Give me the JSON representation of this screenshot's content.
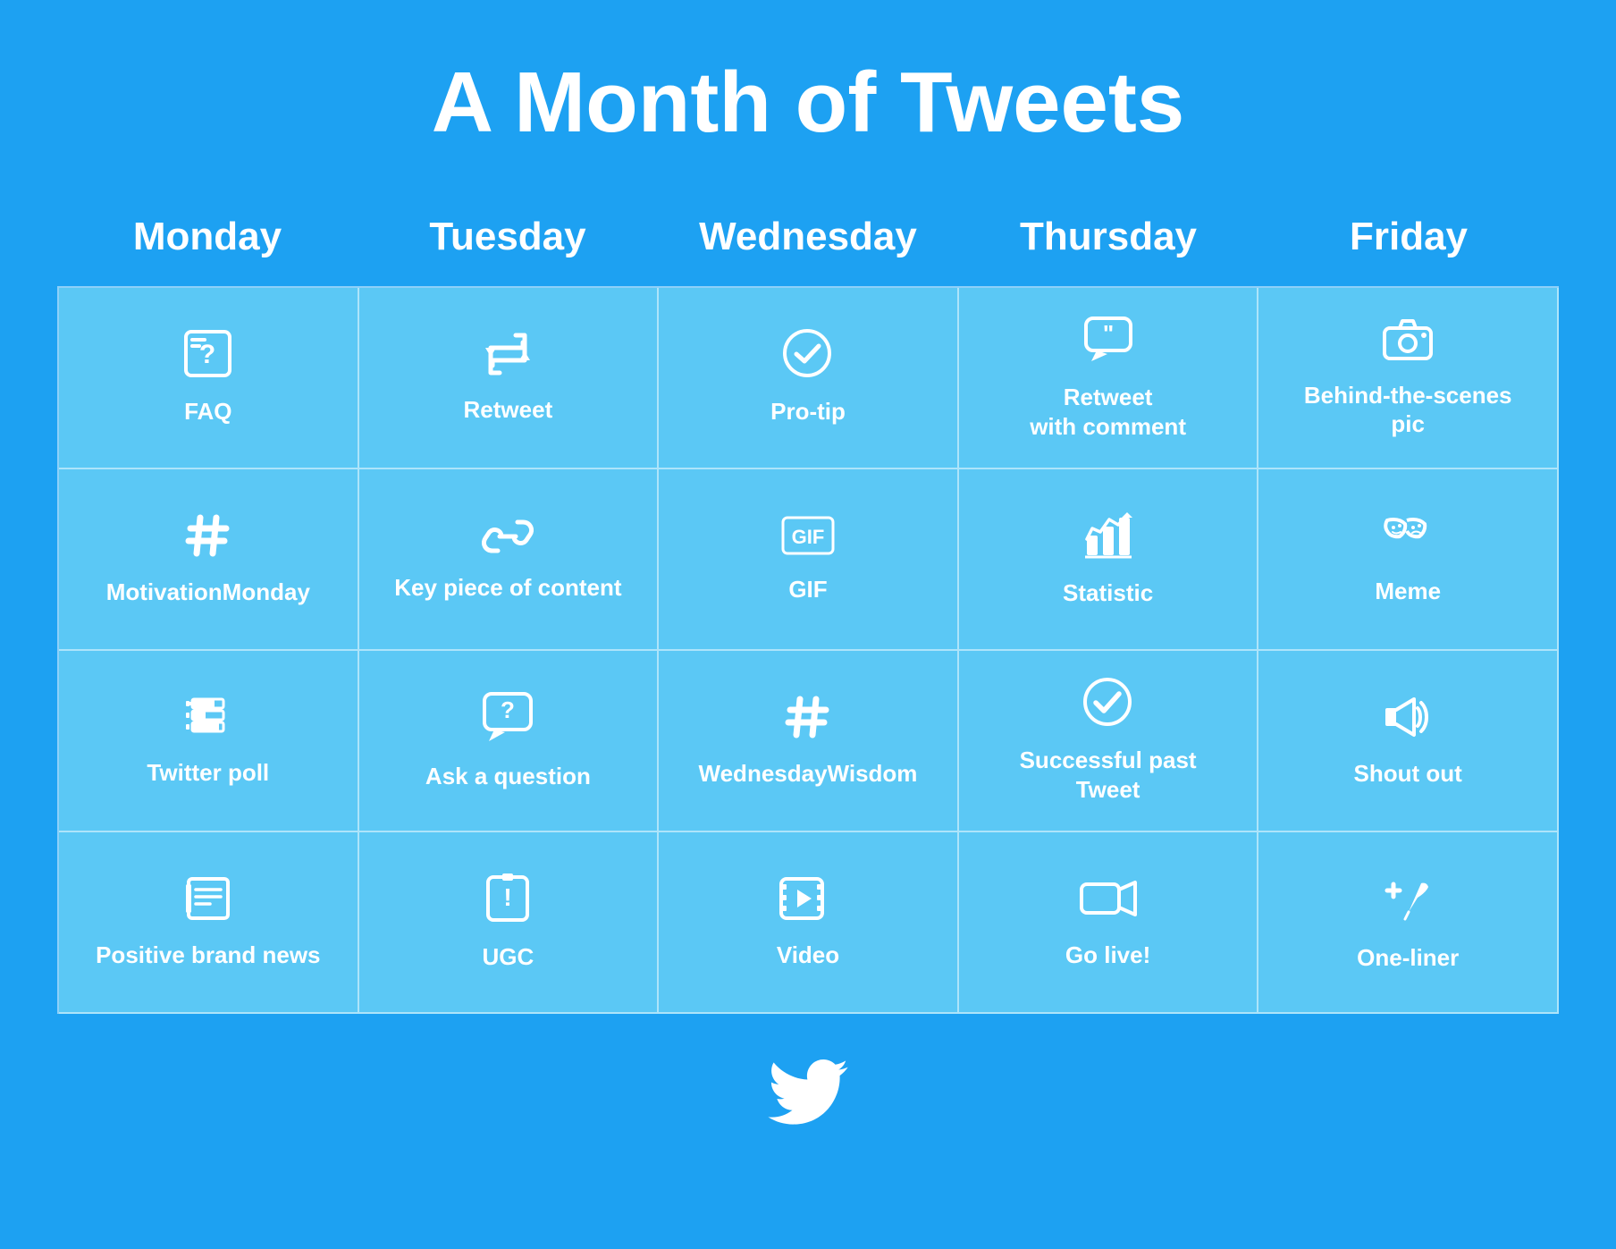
{
  "title": "A Month of Tweets",
  "days": [
    {
      "label": "Monday"
    },
    {
      "label": "Tuesday"
    },
    {
      "label": "Wednesday"
    },
    {
      "label": "Thursday"
    },
    {
      "label": "Friday"
    }
  ],
  "cells": [
    {
      "icon": "❓📋",
      "unicode": "🗒",
      "label": "FAQ",
      "icon_symbol": "faq"
    },
    {
      "icon": "🔁",
      "label": "Retweet",
      "icon_symbol": "retweet"
    },
    {
      "icon": "✅",
      "label": "Pro-tip",
      "icon_symbol": "protip"
    },
    {
      "icon": "💬",
      "label": "Retweet\nwith comment",
      "icon_symbol": "retweet-comment"
    },
    {
      "icon": "📷",
      "label": "Behind-the-scenes\npic",
      "icon_symbol": "camera"
    },
    {
      "icon": "#",
      "label": "MotivationMonday",
      "icon_symbol": "hashtag"
    },
    {
      "icon": "🔗",
      "label": "Key piece of content",
      "icon_symbol": "link"
    },
    {
      "icon": "GIF",
      "label": "GIF",
      "icon_symbol": "gif"
    },
    {
      "icon": "📊",
      "label": "Statistic",
      "icon_symbol": "chart"
    },
    {
      "icon": "🎭",
      "label": "Meme",
      "icon_symbol": "masks"
    },
    {
      "icon": "📋",
      "label": "Twitter poll",
      "icon_symbol": "poll"
    },
    {
      "icon": "❓💬",
      "label": "Ask a question",
      "icon_symbol": "question"
    },
    {
      "icon": "#",
      "label": "WednesdayWisdom",
      "icon_symbol": "hashtag"
    },
    {
      "icon": "✅",
      "label": "Successful past\nTweet",
      "icon_symbol": "check"
    },
    {
      "icon": "📢",
      "label": "Shout out",
      "icon_symbol": "megaphone"
    },
    {
      "icon": "📰",
      "label": "Positive brand news",
      "icon_symbol": "newspaper"
    },
    {
      "icon": "❗📱",
      "label": "UGC",
      "icon_symbol": "ugc"
    },
    {
      "icon": "▶️",
      "label": "Video",
      "icon_symbol": "video"
    },
    {
      "icon": "🎥",
      "label": "Go live!",
      "icon_symbol": "camera-live"
    },
    {
      "icon": "✏️+",
      "label": "One-liner",
      "icon_symbol": "pen-plus"
    }
  ]
}
